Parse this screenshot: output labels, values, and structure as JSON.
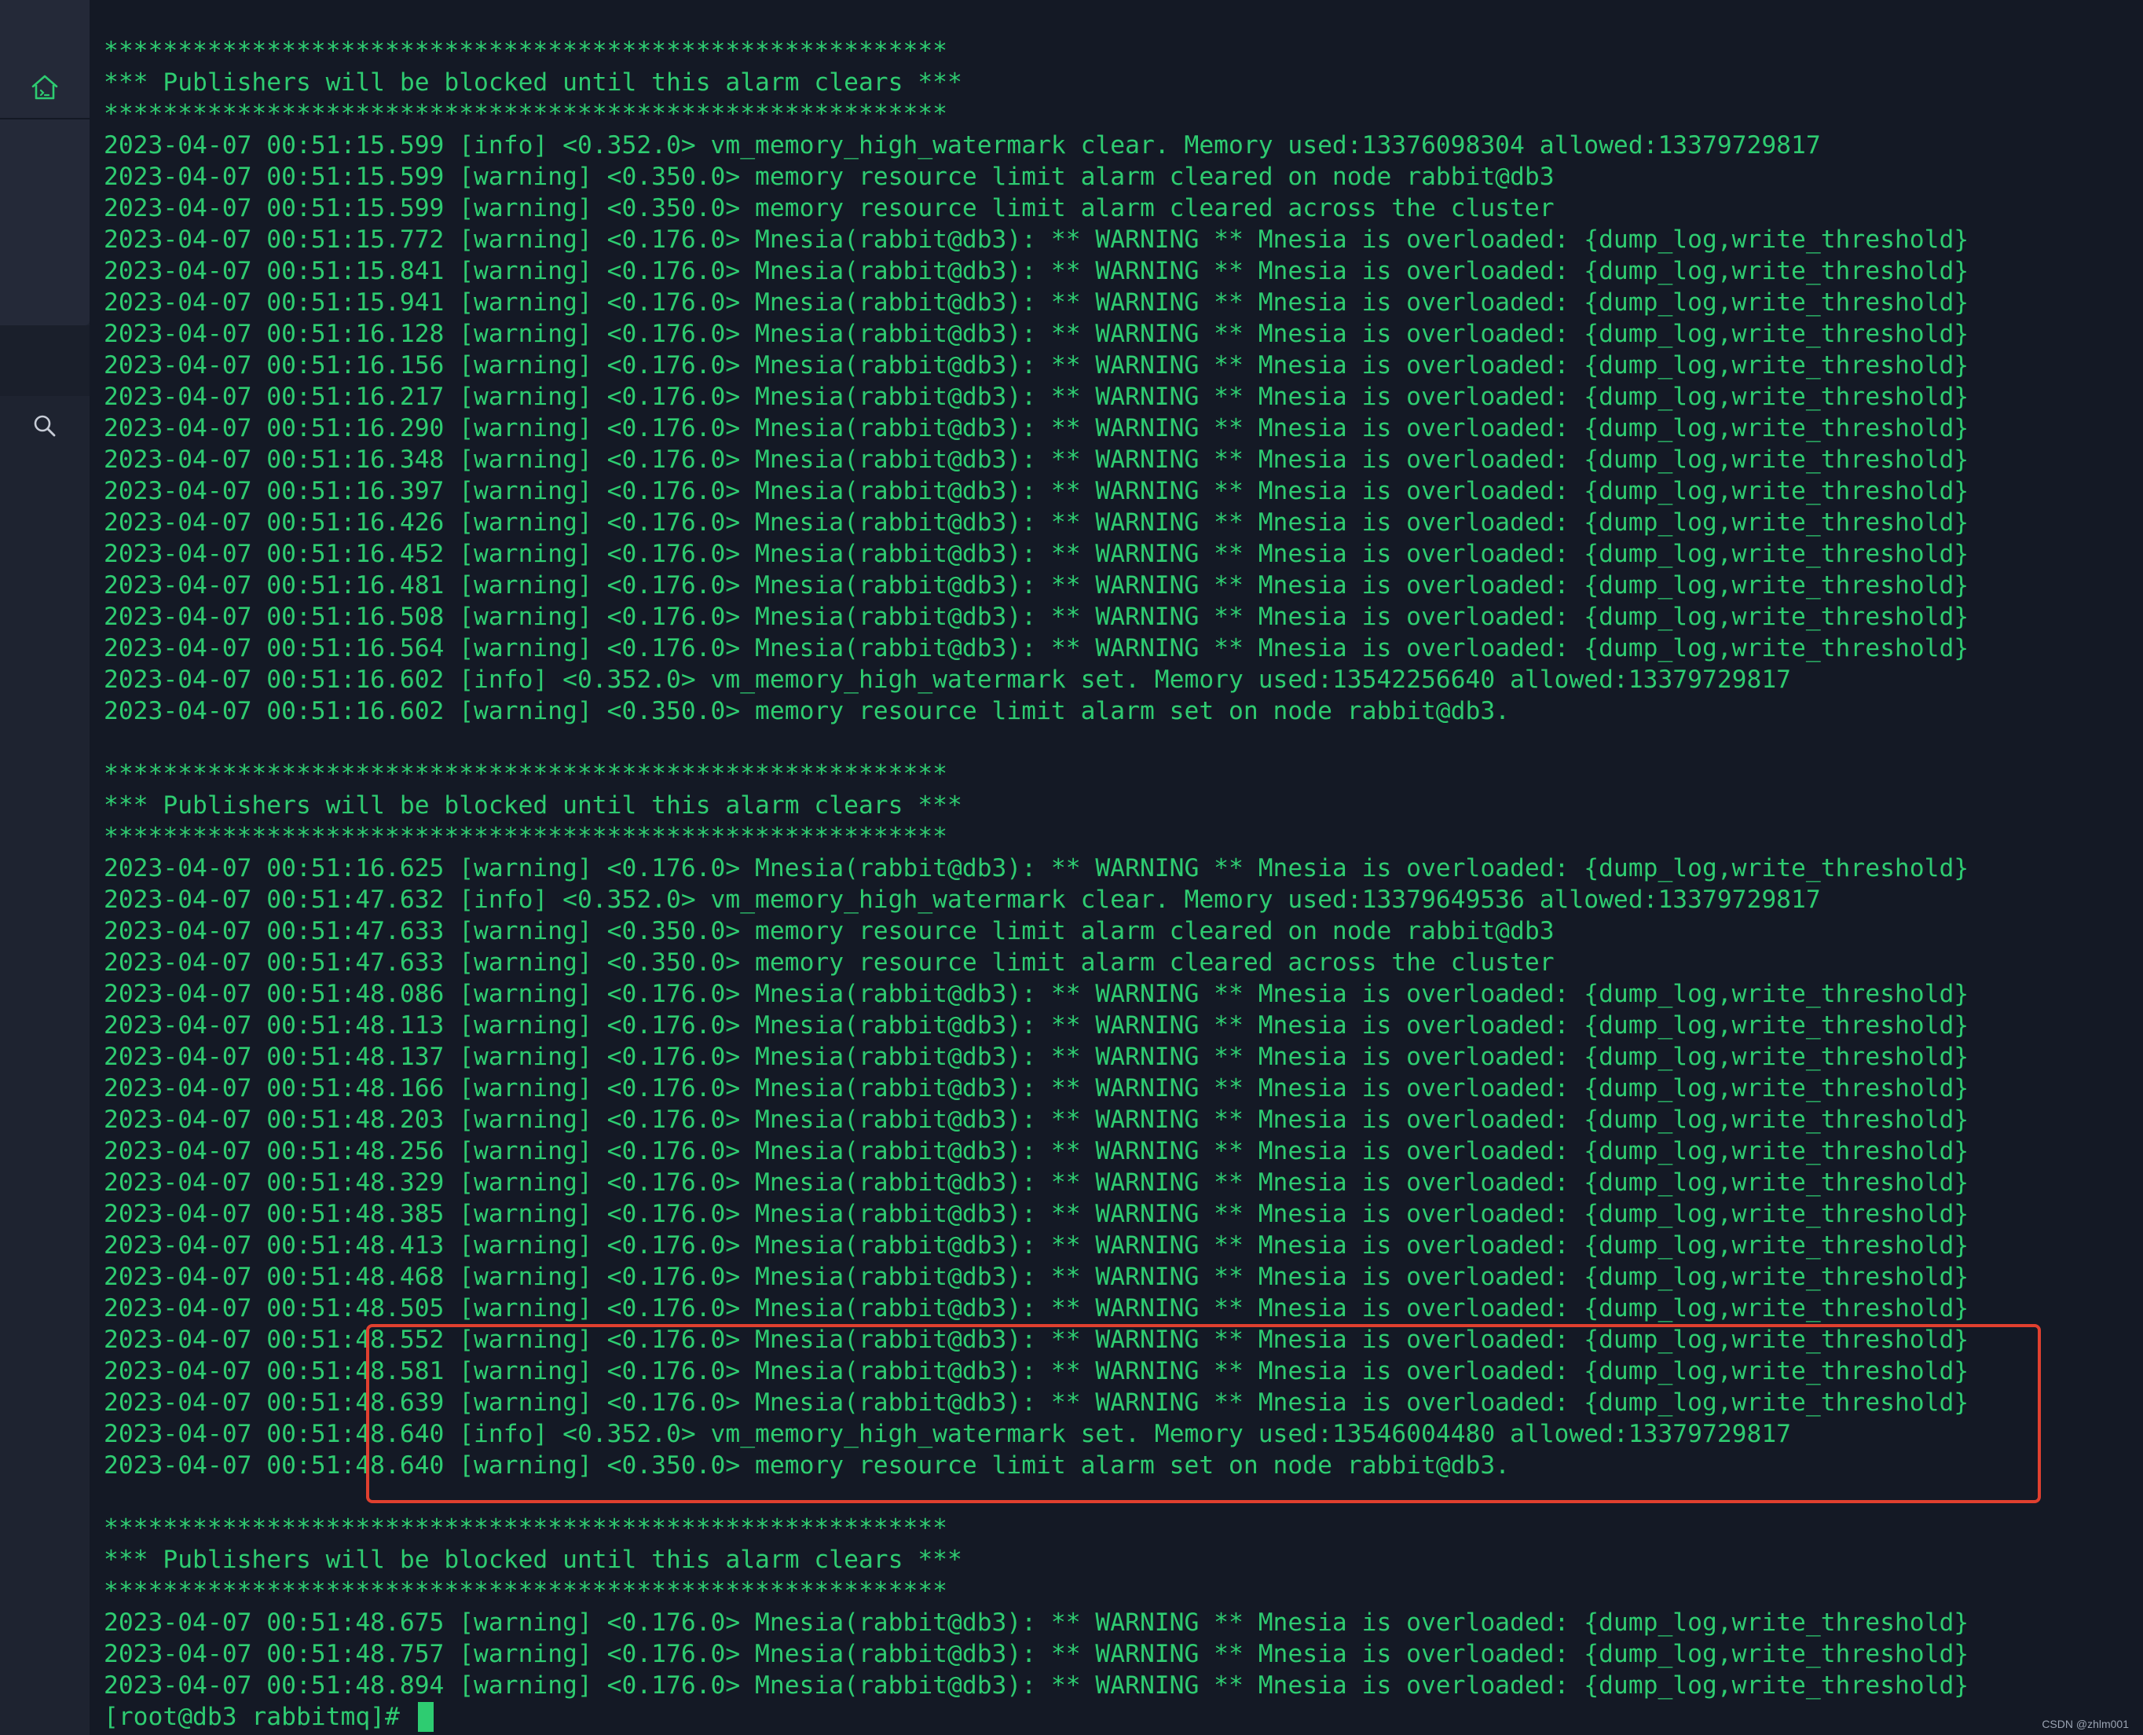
{
  "sidebar": {
    "icons": [
      {
        "name": "home-icon",
        "color": "#2ecc71"
      },
      {
        "name": "search-icon",
        "color": "#c7ccd6"
      }
    ]
  },
  "terminal": {
    "text_color": "#2ecc71",
    "background": "#141925",
    "lines": [
      "*********************************************************",
      "*** Publishers will be blocked until this alarm clears ***",
      "*********************************************************",
      "2023-04-07 00:51:15.599 [info] <0.352.0> vm_memory_high_watermark clear. Memory used:13376098304 allowed:13379729817",
      "2023-04-07 00:51:15.599 [warning] <0.350.0> memory resource limit alarm cleared on node rabbit@db3",
      "2023-04-07 00:51:15.599 [warning] <0.350.0> memory resource limit alarm cleared across the cluster",
      "2023-04-07 00:51:15.772 [warning] <0.176.0> Mnesia(rabbit@db3): ** WARNING ** Mnesia is overloaded: {dump_log,write_threshold}",
      "2023-04-07 00:51:15.841 [warning] <0.176.0> Mnesia(rabbit@db3): ** WARNING ** Mnesia is overloaded: {dump_log,write_threshold}",
      "2023-04-07 00:51:15.941 [warning] <0.176.0> Mnesia(rabbit@db3): ** WARNING ** Mnesia is overloaded: {dump_log,write_threshold}",
      "2023-04-07 00:51:16.128 [warning] <0.176.0> Mnesia(rabbit@db3): ** WARNING ** Mnesia is overloaded: {dump_log,write_threshold}",
      "2023-04-07 00:51:16.156 [warning] <0.176.0> Mnesia(rabbit@db3): ** WARNING ** Mnesia is overloaded: {dump_log,write_threshold}",
      "2023-04-07 00:51:16.217 [warning] <0.176.0> Mnesia(rabbit@db3): ** WARNING ** Mnesia is overloaded: {dump_log,write_threshold}",
      "2023-04-07 00:51:16.290 [warning] <0.176.0> Mnesia(rabbit@db3): ** WARNING ** Mnesia is overloaded: {dump_log,write_threshold}",
      "2023-04-07 00:51:16.348 [warning] <0.176.0> Mnesia(rabbit@db3): ** WARNING ** Mnesia is overloaded: {dump_log,write_threshold}",
      "2023-04-07 00:51:16.397 [warning] <0.176.0> Mnesia(rabbit@db3): ** WARNING ** Mnesia is overloaded: {dump_log,write_threshold}",
      "2023-04-07 00:51:16.426 [warning] <0.176.0> Mnesia(rabbit@db3): ** WARNING ** Mnesia is overloaded: {dump_log,write_threshold}",
      "2023-04-07 00:51:16.452 [warning] <0.176.0> Mnesia(rabbit@db3): ** WARNING ** Mnesia is overloaded: {dump_log,write_threshold}",
      "2023-04-07 00:51:16.481 [warning] <0.176.0> Mnesia(rabbit@db3): ** WARNING ** Mnesia is overloaded: {dump_log,write_threshold}",
      "2023-04-07 00:51:16.508 [warning] <0.176.0> Mnesia(rabbit@db3): ** WARNING ** Mnesia is overloaded: {dump_log,write_threshold}",
      "2023-04-07 00:51:16.564 [warning] <0.176.0> Mnesia(rabbit@db3): ** WARNING ** Mnesia is overloaded: {dump_log,write_threshold}",
      "2023-04-07 00:51:16.602 [info] <0.352.0> vm_memory_high_watermark set. Memory used:13542256640 allowed:13379729817",
      "2023-04-07 00:51:16.602 [warning] <0.350.0> memory resource limit alarm set on node rabbit@db3.",
      "",
      "*********************************************************",
      "*** Publishers will be blocked until this alarm clears ***",
      "*********************************************************",
      "2023-04-07 00:51:16.625 [warning] <0.176.0> Mnesia(rabbit@db3): ** WARNING ** Mnesia is overloaded: {dump_log,write_threshold}",
      "2023-04-07 00:51:47.632 [info] <0.352.0> vm_memory_high_watermark clear. Memory used:13379649536 allowed:13379729817",
      "2023-04-07 00:51:47.633 [warning] <0.350.0> memory resource limit alarm cleared on node rabbit@db3",
      "2023-04-07 00:51:47.633 [warning] <0.350.0> memory resource limit alarm cleared across the cluster",
      "2023-04-07 00:51:48.086 [warning] <0.176.0> Mnesia(rabbit@db3): ** WARNING ** Mnesia is overloaded: {dump_log,write_threshold}",
      "2023-04-07 00:51:48.113 [warning] <0.176.0> Mnesia(rabbit@db3): ** WARNING ** Mnesia is overloaded: {dump_log,write_threshold}",
      "2023-04-07 00:51:48.137 [warning] <0.176.0> Mnesia(rabbit@db3): ** WARNING ** Mnesia is overloaded: {dump_log,write_threshold}",
      "2023-04-07 00:51:48.166 [warning] <0.176.0> Mnesia(rabbit@db3): ** WARNING ** Mnesia is overloaded: {dump_log,write_threshold}",
      "2023-04-07 00:51:48.203 [warning] <0.176.0> Mnesia(rabbit@db3): ** WARNING ** Mnesia is overloaded: {dump_log,write_threshold}",
      "2023-04-07 00:51:48.256 [warning] <0.176.0> Mnesia(rabbit@db3): ** WARNING ** Mnesia is overloaded: {dump_log,write_threshold}",
      "2023-04-07 00:51:48.329 [warning] <0.176.0> Mnesia(rabbit@db3): ** WARNING ** Mnesia is overloaded: {dump_log,write_threshold}",
      "2023-04-07 00:51:48.385 [warning] <0.176.0> Mnesia(rabbit@db3): ** WARNING ** Mnesia is overloaded: {dump_log,write_threshold}",
      "2023-04-07 00:51:48.413 [warning] <0.176.0> Mnesia(rabbit@db3): ** WARNING ** Mnesia is overloaded: {dump_log,write_threshold}",
      "2023-04-07 00:51:48.468 [warning] <0.176.0> Mnesia(rabbit@db3): ** WARNING ** Mnesia is overloaded: {dump_log,write_threshold}",
      "2023-04-07 00:51:48.505 [warning] <0.176.0> Mnesia(rabbit@db3): ** WARNING ** Mnesia is overloaded: {dump_log,write_threshold}",
      "2023-04-07 00:51:48.552 [warning] <0.176.0> Mnesia(rabbit@db3): ** WARNING ** Mnesia is overloaded: {dump_log,write_threshold}",
      "2023-04-07 00:51:48.581 [warning] <0.176.0> Mnesia(rabbit@db3): ** WARNING ** Mnesia is overloaded: {dump_log,write_threshold}",
      "2023-04-07 00:51:48.639 [warning] <0.176.0> Mnesia(rabbit@db3): ** WARNING ** Mnesia is overloaded: {dump_log,write_threshold}",
      "2023-04-07 00:51:48.640 [info] <0.352.0> vm_memory_high_watermark set. Memory used:13546004480 allowed:13379729817",
      "2023-04-07 00:51:48.640 [warning] <0.350.0> memory resource limit alarm set on node rabbit@db3.",
      "",
      "*********************************************************",
      "*** Publishers will be blocked until this alarm clears ***",
      "*********************************************************",
      "2023-04-07 00:51:48.675 [warning] <0.176.0> Mnesia(rabbit@db3): ** WARNING ** Mnesia is overloaded: {dump_log,write_threshold}",
      "2023-04-07 00:51:48.757 [warning] <0.176.0> Mnesia(rabbit@db3): ** WARNING ** Mnesia is overloaded: {dump_log,write_threshold}",
      "2023-04-07 00:51:48.894 [warning] <0.176.0> Mnesia(rabbit@db3): ** WARNING ** Mnesia is overloaded: {dump_log,write_threshold}"
    ],
    "prompt": "[root@db3 rabbitmq]# "
  },
  "annotation": {
    "highlight_color": "#e0402f"
  },
  "watermark": "CSDN @zhlm001"
}
